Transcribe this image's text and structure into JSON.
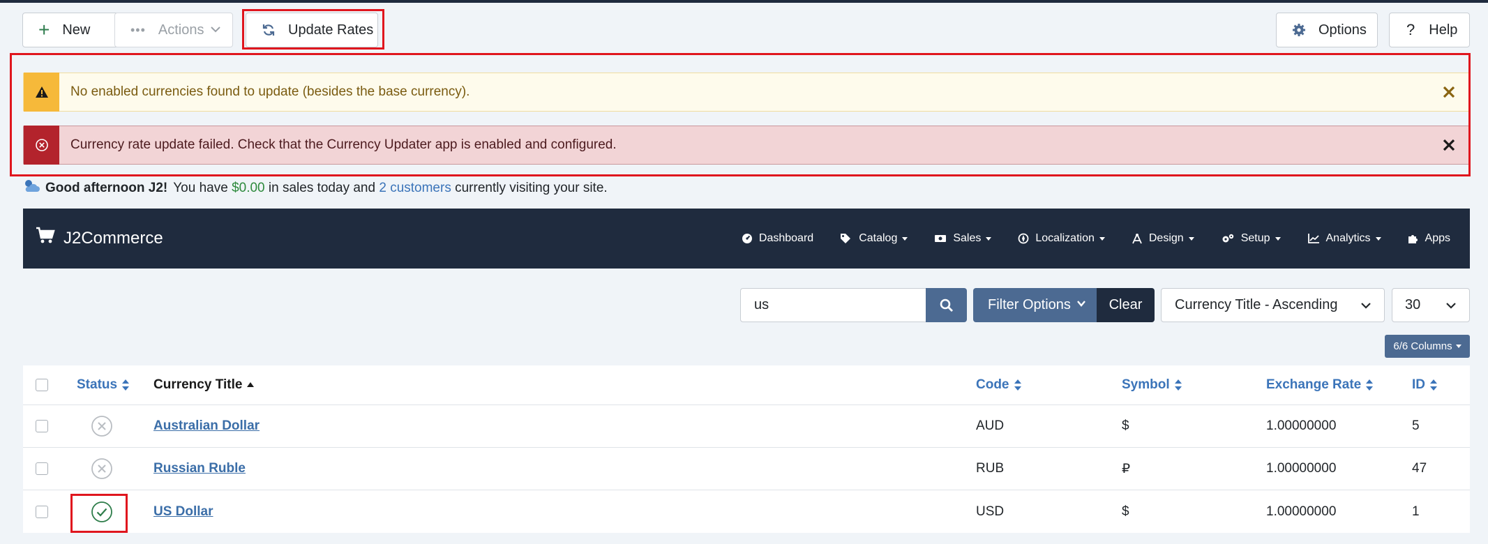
{
  "toolbar": {
    "new_label": "New",
    "actions_label": "Actions",
    "update_rates_label": "Update Rates",
    "options_label": "Options",
    "help_label": "Help"
  },
  "alerts": {
    "warning": "No enabled currencies found to update (besides the base currency).",
    "error": "Currency rate update failed. Check that the Currency Updater app is enabled and configured."
  },
  "greeting": {
    "hello": "Good afternoon J2!",
    "you_have": "You have",
    "sales": "$0.00",
    "mid": "in sales today and",
    "customers": "2 customers",
    "end": "currently visiting your site."
  },
  "navbar": {
    "brand": "J2Commerce",
    "items": [
      {
        "label": "Dashboard",
        "icon": "dashboard-icon",
        "caret": false
      },
      {
        "label": "Catalog",
        "icon": "tags-icon",
        "caret": true
      },
      {
        "label": "Sales",
        "icon": "money-icon",
        "caret": true
      },
      {
        "label": "Localization",
        "icon": "compass-icon",
        "caret": true
      },
      {
        "label": "Design",
        "icon": "compass-drafting-icon",
        "caret": true
      },
      {
        "label": "Setup",
        "icon": "gears-icon",
        "caret": true
      },
      {
        "label": "Analytics",
        "icon": "chart-line-icon",
        "caret": true
      },
      {
        "label": "Apps",
        "icon": "puzzle-icon",
        "caret": false
      }
    ]
  },
  "filters": {
    "search_value": "us",
    "filter_options_label": "Filter Options",
    "clear_label": "Clear",
    "ordering_selected": "Currency Title - Ascending",
    "limit_selected": "30",
    "columns_label": "6/6 Columns"
  },
  "table": {
    "headers": {
      "status": "Status",
      "title": "Currency Title",
      "code": "Code",
      "symbol": "Symbol",
      "rate": "Exchange Rate",
      "id": "ID"
    },
    "rows": [
      {
        "status": "disabled",
        "title": "Australian Dollar",
        "code": "AUD",
        "symbol": "$",
        "rate": "1.00000000",
        "id": "5"
      },
      {
        "status": "disabled",
        "title": "Russian Ruble",
        "code": "RUB",
        "symbol": "₽",
        "rate": "1.00000000",
        "id": "47"
      },
      {
        "status": "enabled",
        "title": "US Dollar",
        "code": "USD",
        "symbol": "$",
        "rate": "1.00000000",
        "id": "1"
      }
    ]
  },
  "colors": {
    "navbar_bg": "#1f2b3e",
    "primary": "#4c6a92",
    "warning": "#f6b93a",
    "danger": "#b3232c",
    "success": "#2e8a3d",
    "highlight": "#e0161e"
  }
}
